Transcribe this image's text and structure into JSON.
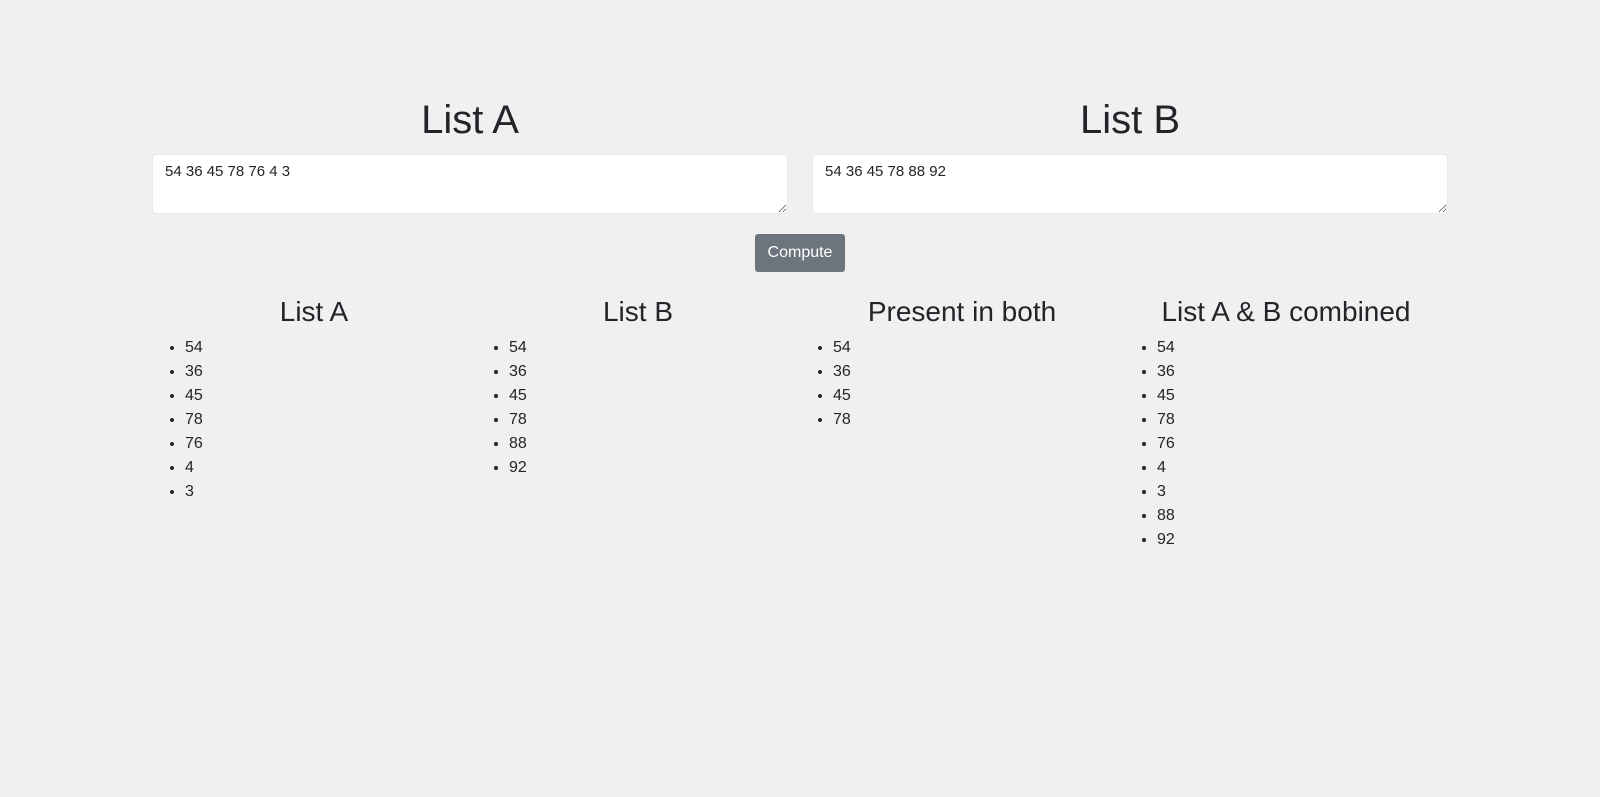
{
  "inputs": {
    "list_a": {
      "title": "List A",
      "value": "54 36 45 78 76 4 3"
    },
    "list_b": {
      "title": "List B",
      "value": "54 36 45 78 88 92"
    }
  },
  "compute_label": "Compute",
  "results": {
    "list_a": {
      "title": "List A",
      "items": [
        "54",
        "36",
        "45",
        "78",
        "76",
        "4",
        "3"
      ]
    },
    "list_b": {
      "title": "List B",
      "items": [
        "54",
        "36",
        "45",
        "78",
        "88",
        "92"
      ]
    },
    "both": {
      "title": "Present in both",
      "items": [
        "54",
        "36",
        "45",
        "78"
      ]
    },
    "combined": {
      "title": "List A & B combined",
      "items": [
        "54",
        "36",
        "45",
        "78",
        "76",
        "4",
        "3",
        "88",
        "92"
      ]
    }
  },
  "colors": {
    "background": "#f0f0f0",
    "button": "#6c757d",
    "text": "#212529"
  }
}
